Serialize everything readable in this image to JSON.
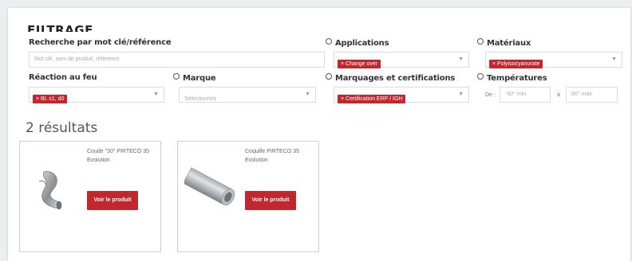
{
  "colors": {
    "accent": "#c1272d",
    "border": "#dcdcdc",
    "background": "#eceef0"
  },
  "filter": {
    "title": "FILTRAGE",
    "search": {
      "label": "Recherche par mot clé/référence",
      "placeholder": "Mot clé, nom de produit, référence"
    },
    "applications": {
      "label": "Applications",
      "tag": "× Change over"
    },
    "materiaux": {
      "label": "Matériaux",
      "tag": "× Polyisocyanurate"
    },
    "reaction_feu": {
      "label": "Réaction au feu",
      "tag": "× BL s1, d0"
    },
    "marque": {
      "label": "Marque",
      "placeholder": "Sélectionnez"
    },
    "marquages": {
      "label": "Marquages et certifications",
      "tag": "× Certification ERP / IGH"
    },
    "temperatures": {
      "label": "Températures",
      "from_label": "De :",
      "min_placeholder": "-50° min",
      "to_label": "à",
      "max_placeholder": "80° max"
    }
  },
  "results": {
    "count_text": "2 résultats",
    "products": [
      {
        "title": "Coude \"30\" PIRTECO 35 Evolution",
        "button": "Voir le produit",
        "image": "elbow-pipe"
      },
      {
        "title": "Coquille PIRTECO 35 Evolution",
        "button": "Voir le produit",
        "image": "straight-pipe"
      }
    ]
  }
}
